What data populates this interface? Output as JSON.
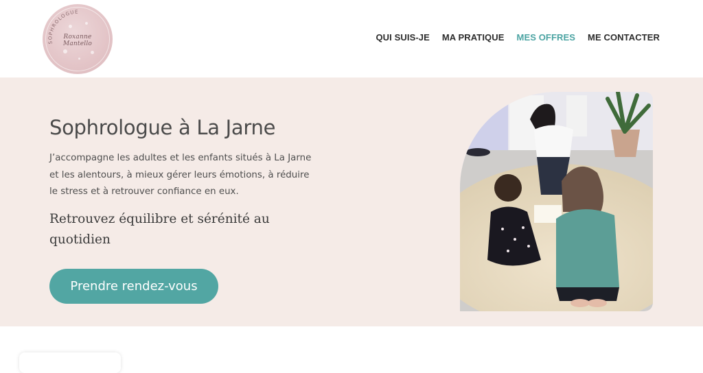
{
  "logo": {
    "arc_text": "SOPHROLOGUE",
    "name": "Roxanne Mantello"
  },
  "nav": {
    "items": [
      {
        "label": "QUI SUIS-JE",
        "active": false
      },
      {
        "label": "MA PRATIQUE",
        "active": false
      },
      {
        "label": "MES OFFRES",
        "active": true
      },
      {
        "label": "ME CONTACTER",
        "active": false
      }
    ]
  },
  "hero": {
    "title": "Sophrologue à La Jarne",
    "text": "J’accompagne les adultes et les enfants situés à La Jarne et les alentours, à mieux gérer leurs émotions, à réduire le stress et à retrouver confiance en eux.",
    "subtitle": "Retrouvez équilibre et sérénité au quotidien",
    "cta_label": "Prendre rendez-vous"
  },
  "colors": {
    "accent": "#52a6a3",
    "nav_active": "#4aa3a2",
    "hero_bg": "#f5ebe7",
    "logo_pink": "#e3c4c7",
    "text_dark": "#2b2b2b"
  }
}
